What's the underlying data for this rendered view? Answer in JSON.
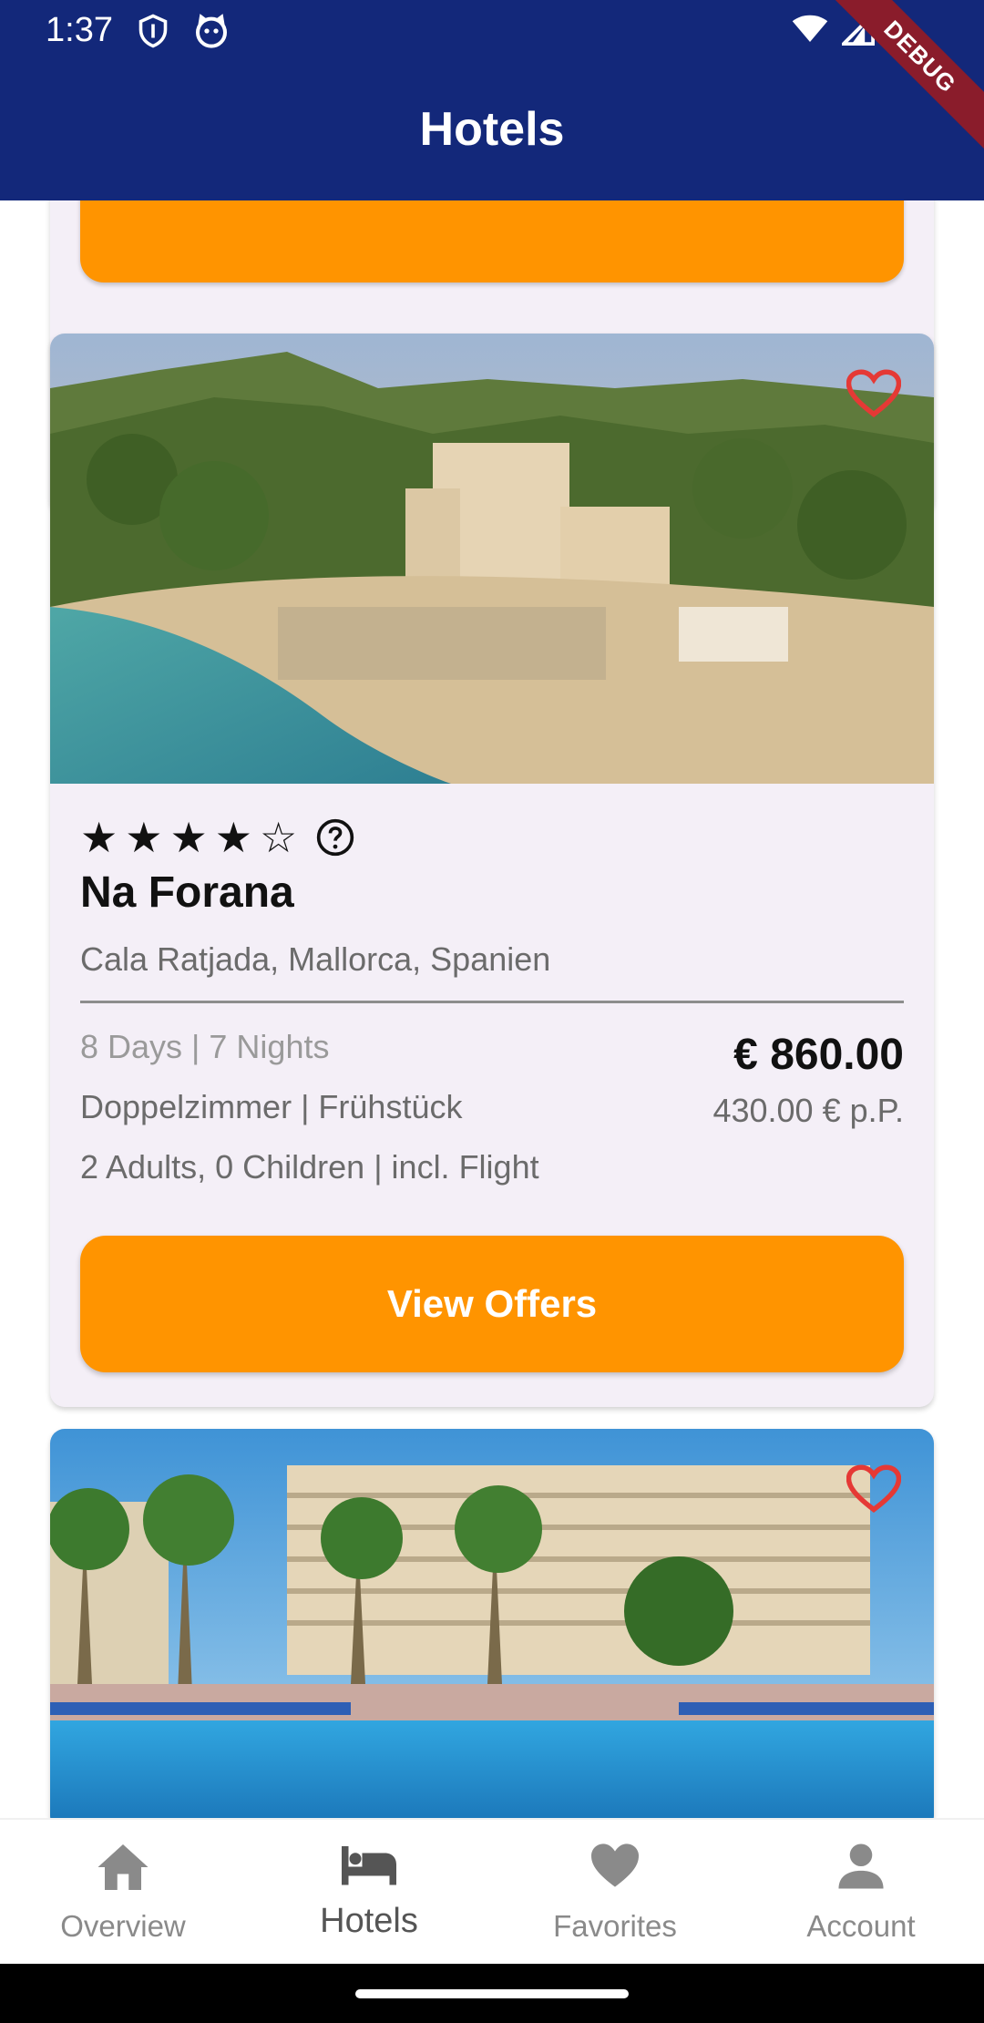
{
  "status_bar": {
    "time": "1:37"
  },
  "app_bar": {
    "title": "Hotels",
    "debug_label": "DEBUG"
  },
  "hotel_card": {
    "rating_stars": 4,
    "max_stars": 5,
    "name": "Na Forana",
    "location": "Cala Ratjada, Mallorca, Spanien",
    "duration": "8 Days | 7 Nights",
    "room_board": "Doppelzimmer | Frühstück",
    "travellers": "2 Adults, 0 Children | incl. Flight",
    "price_total": "€ 860.00",
    "price_per_person": "430.00 € p.P.",
    "button_label": "View Offers"
  },
  "bottom_nav": {
    "items": [
      {
        "label": "Overview",
        "icon": "home-icon"
      },
      {
        "label": "Hotels",
        "icon": "bed-icon"
      },
      {
        "label": "Favorites",
        "icon": "heart-icon"
      },
      {
        "label": "Account",
        "icon": "person-icon"
      }
    ],
    "active": "Hotels"
  },
  "colors": {
    "app_bar": "#13287a",
    "accent_orange": "#ff9400",
    "card_bg": "#f4eff7",
    "favorite_red": "#e53935"
  }
}
